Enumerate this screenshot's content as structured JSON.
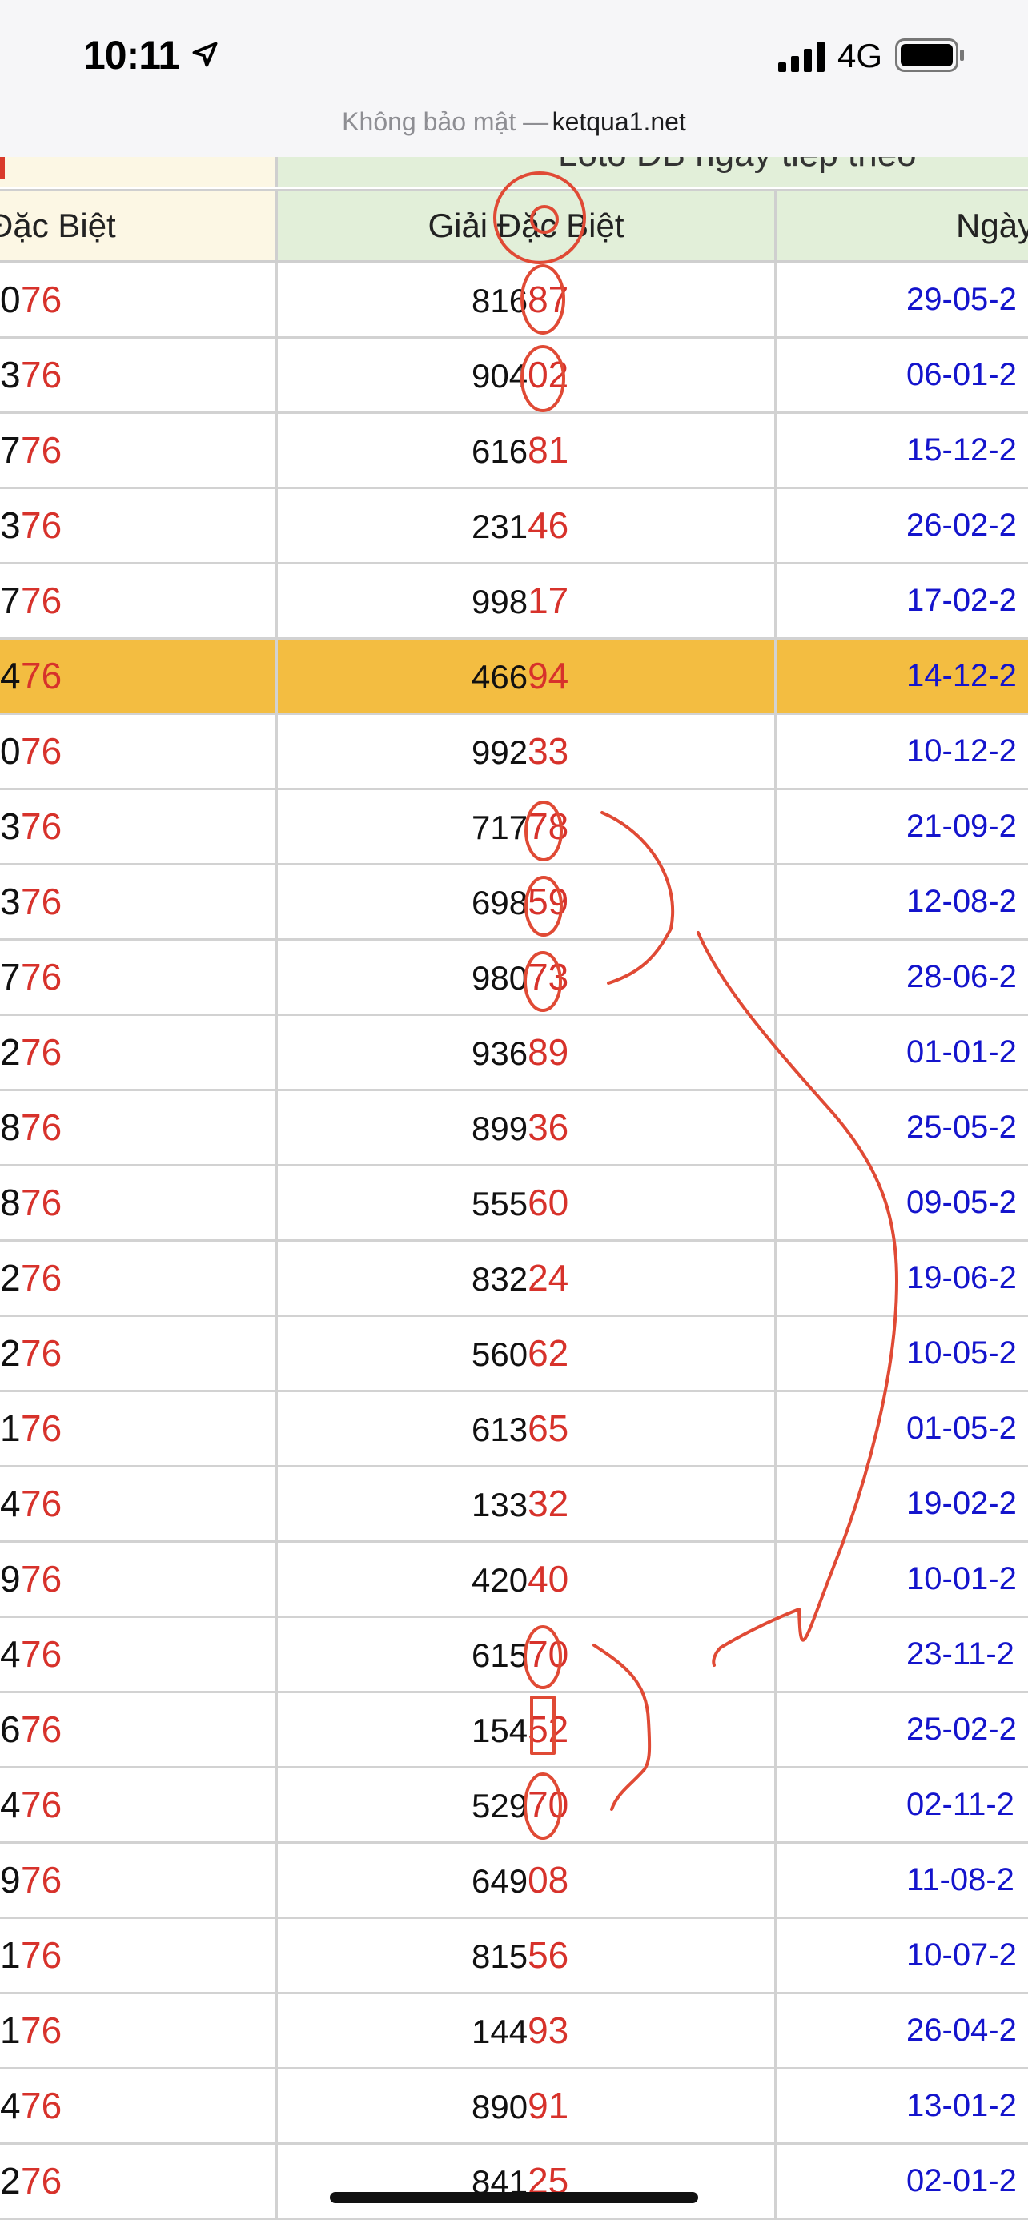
{
  "status": {
    "time": "10:11",
    "network": "4G"
  },
  "address": {
    "insecure_text": "Không bảo mật —",
    "domain": "ketqua1.net"
  },
  "table": {
    "top_header_text": "Loto ĐB ngày tiếp theo",
    "col1_header": "Đặc Biệt",
    "col2_header": "Giải Đặc Biệt",
    "col3_header": "Ngày",
    "rows": [
      {
        "c1a": "0",
        "c1b": "76",
        "c2a": "816",
        "c2b": "87",
        "c3": "29-05-2"
      },
      {
        "c1a": "3",
        "c1b": "76",
        "c2a": "904",
        "c2b": "02",
        "c3": "06-01-2"
      },
      {
        "c1a": "7",
        "c1b": "76",
        "c2a": "616",
        "c2b": "81",
        "c3": "15-12-2"
      },
      {
        "c1a": "3",
        "c1b": "76",
        "c2a": "231",
        "c2b": "46",
        "c3": "26-02-2"
      },
      {
        "c1a": "7",
        "c1b": "76",
        "c2a": "998",
        "c2b": "17",
        "c3": "17-02-2"
      },
      {
        "c1a": "4",
        "c1b": "76",
        "c2a": "466",
        "c2b": "94",
        "c3": "14-12-2",
        "highlight": true
      },
      {
        "c1a": "0",
        "c1b": "76",
        "c2a": "992",
        "c2b": "33",
        "c3": "10-12-2"
      },
      {
        "c1a": "3",
        "c1b": "76",
        "c2a": "717",
        "c2b": "78",
        "c3": "21-09-2"
      },
      {
        "c1a": "3",
        "c1b": "76",
        "c2a": "698",
        "c2b": "59",
        "c3": "12-08-2"
      },
      {
        "c1a": "7",
        "c1b": "76",
        "c2a": "980",
        "c2b": "73",
        "c3": "28-06-2"
      },
      {
        "c1a": "2",
        "c1b": "76",
        "c2a": "936",
        "c2b": "89",
        "c3": "01-01-2"
      },
      {
        "c1a": "8",
        "c1b": "76",
        "c2a": "899",
        "c2b": "36",
        "c3": "25-05-2"
      },
      {
        "c1a": "8",
        "c1b": "76",
        "c2a": "555",
        "c2b": "60",
        "c3": "09-05-2"
      },
      {
        "c1a": "2",
        "c1b": "76",
        "c2a": "832",
        "c2b": "24",
        "c3": "19-06-2"
      },
      {
        "c1a": "2",
        "c1b": "76",
        "c2a": "560",
        "c2b": "62",
        "c3": "10-05-2"
      },
      {
        "c1a": "1",
        "c1b": "76",
        "c2a": "613",
        "c2b": "65",
        "c3": "01-05-2"
      },
      {
        "c1a": "4",
        "c1b": "76",
        "c2a": "133",
        "c2b": "32",
        "c3": "19-02-2"
      },
      {
        "c1a": "9",
        "c1b": "76",
        "c2a": "420",
        "c2b": "40",
        "c3": "10-01-2"
      },
      {
        "c1a": "4",
        "c1b": "76",
        "c2a": "615",
        "c2b": "70",
        "c3": "23-11-2"
      },
      {
        "c1a": "6",
        "c1b": "76",
        "c2a": "154",
        "c2b": "52",
        "c3": "25-02-2"
      },
      {
        "c1a": "4",
        "c1b": "76",
        "c2a": "529",
        "c2b": "70",
        "c3": "02-11-2"
      },
      {
        "c1a": "9",
        "c1b": "76",
        "c2a": "649",
        "c2b": "08",
        "c3": "11-08-2"
      },
      {
        "c1a": "1",
        "c1b": "76",
        "c2a": "815",
        "c2b": "56",
        "c3": "10-07-2"
      },
      {
        "c1a": "1",
        "c1b": "76",
        "c2a": "144",
        "c2b": "93",
        "c3": "26-04-2"
      },
      {
        "c1a": "4",
        "c1b": "76",
        "c2a": "890",
        "c2b": "91",
        "c3": "13-01-2"
      },
      {
        "c1a": "2",
        "c1b": "76",
        "c2a": "841",
        "c2b": "25",
        "c3": "02-01-2"
      }
    ]
  },
  "colors": {
    "red": "#d7322b",
    "blue": "#1414cc",
    "highlight": "#f3bd41",
    "header_green": "#e2efd9",
    "header_cream": "#fcf7e4",
    "annotation_red": "#e04a35"
  }
}
